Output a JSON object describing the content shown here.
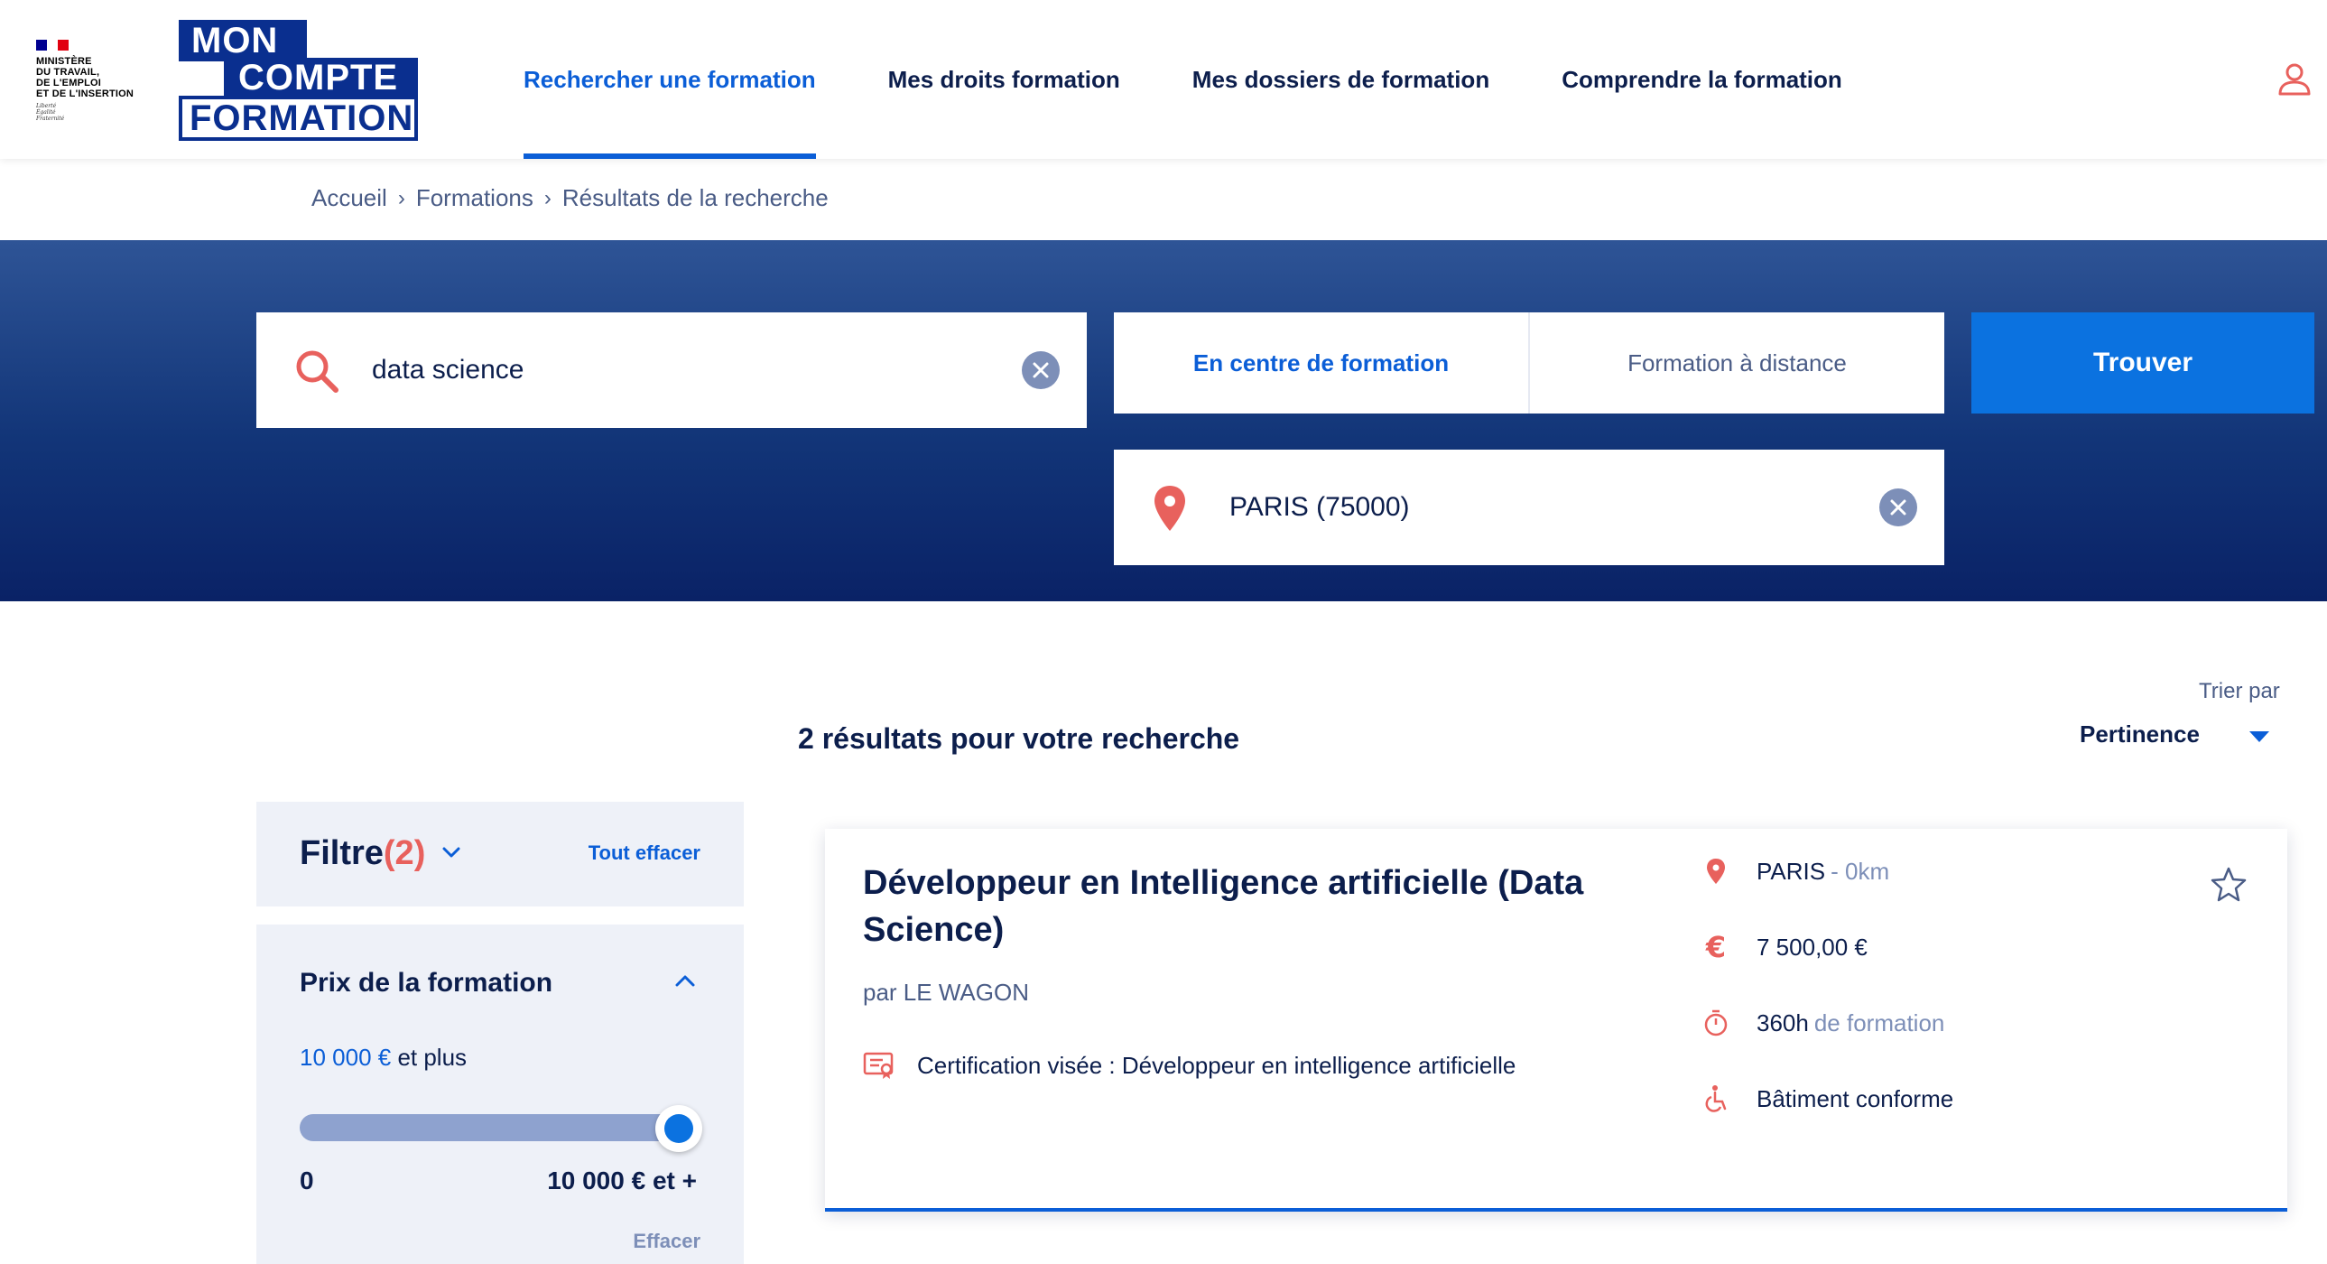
{
  "header": {
    "ministry_lines": [
      "MINISTÈRE",
      "DU TRAVAIL,",
      "DE L'EMPLOI",
      "ET DE L'INSERTION"
    ],
    "motto_lines": [
      "Liberté",
      "Égalité",
      "Fraternité"
    ],
    "logo": {
      "line1": "MON",
      "line2": "COMPTE",
      "line3": "FORMATION"
    },
    "nav": [
      {
        "label": "Rechercher une formation",
        "active": true
      },
      {
        "label": "Mes droits formation",
        "active": false
      },
      {
        "label": "Mes dossiers de formation",
        "active": false
      },
      {
        "label": "Comprendre la formation",
        "active": false
      }
    ],
    "user_icon": "user-icon"
  },
  "breadcrumb": [
    "Accueil",
    "Formations",
    "Résultats de la recherche"
  ],
  "search": {
    "query": "data science",
    "mode_center": "En centre de formation",
    "mode_distance": "Formation à distance",
    "find_button": "Trouver",
    "location": "PARIS (75000)"
  },
  "results": {
    "count_text": "2 résultats pour votre recherche",
    "sort_label": "Trier par",
    "sort_value": "Pertinence"
  },
  "filters": {
    "title": "Filtre",
    "count": "(2)",
    "clear_all": "Tout effacer",
    "price": {
      "title": "Prix de la formation",
      "value_amount": "10 000 €",
      "value_suffix": " et plus",
      "slider_min": "0",
      "slider_max": "10 000 € et +",
      "slider_level": 1.0,
      "clear": "Effacer"
    }
  },
  "card": {
    "title": "Développeur en Intelligence artificielle (Data Science)",
    "org": "par LE WAGON",
    "certification": "Certification visée : Développeur en intelligence artificielle",
    "location": "PARIS",
    "distance": "- 0km",
    "price": "7 500,00 €",
    "hours": "360h",
    "hours_suffix": "de formation",
    "accessibility": "Bâtiment conforme"
  },
  "colors": {
    "primary_blue": "#0b5ed7",
    "navy": "#0c1e4c",
    "accent_red": "#e8615d",
    "band_dark": "#0a2266"
  }
}
